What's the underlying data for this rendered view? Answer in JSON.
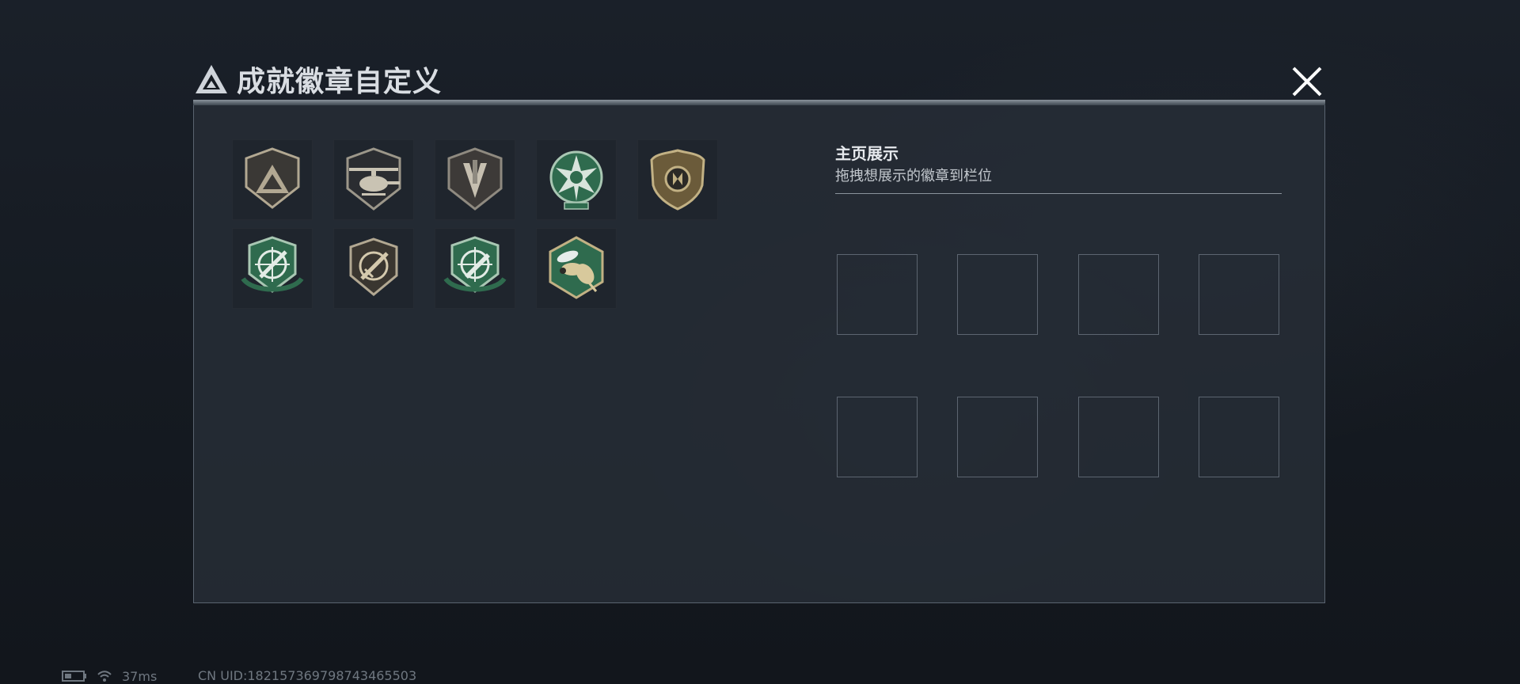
{
  "header": {
    "title": "成就徽章自定义",
    "logo_icon": "triangle-logo-icon",
    "close_icon": "close-icon"
  },
  "badges": [
    {
      "name": "triangle-emblem-badge",
      "color": "#b2a892"
    },
    {
      "name": "helicopter-badge",
      "color": "#b2a892"
    },
    {
      "name": "knife-badge",
      "color": "#b2a892"
    },
    {
      "name": "star-skull-badge",
      "color": "#2f6b4e"
    },
    {
      "name": "gold-shield-badge",
      "color": "#c2b184"
    },
    {
      "name": "crosshair-rifle-badge-green",
      "color": "#2f6b4e"
    },
    {
      "name": "crosshair-rifle-badge-gold",
      "color": "#b2a892"
    },
    {
      "name": "crosshair-blade-badge-green",
      "color": "#2f6b4e"
    },
    {
      "name": "hornet-badge",
      "color": "#2f6b4e"
    }
  ],
  "showcase": {
    "title": "主页展示",
    "subtitle": "拖拽想展示的徽章到栏位",
    "slots": 8
  },
  "status": {
    "latency": "37ms",
    "uid": "CN UID:182157369798743465503",
    "battery_icon": "battery-icon",
    "wifi_icon": "wifi-icon"
  },
  "colors": {
    "panel": "#252c36",
    "accent_green": "#2f6b4e",
    "accent_gold": "#b2a892"
  }
}
